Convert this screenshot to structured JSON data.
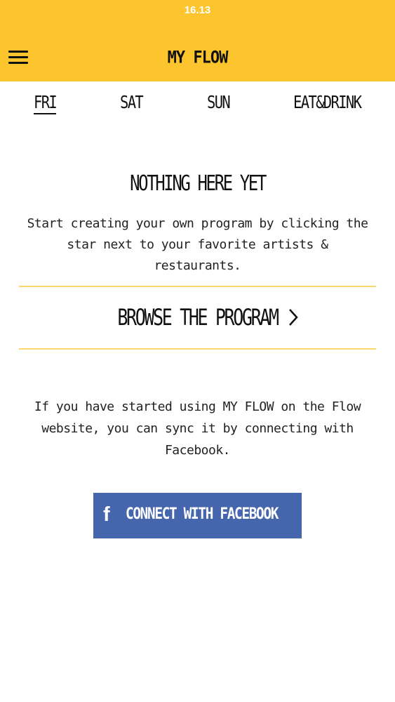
{
  "status_bar": {
    "time": "16.13"
  },
  "header": {
    "title": "MY FLOW",
    "menu_icon": "hamburger-menu-icon",
    "background": "#fcc52e"
  },
  "tabs": [
    {
      "label": "FRI",
      "active": true
    },
    {
      "label": "SAT",
      "active": false
    },
    {
      "label": "SUN",
      "active": false
    },
    {
      "label": "EAT&DRINK",
      "active": false
    }
  ],
  "empty_state": {
    "title": "NOTHING HERE YET",
    "line1": "Start creating your own program by clicking the",
    "line2": "star next to your favorite artists & restaurants."
  },
  "browse": {
    "label": "BROWSE THE PROGRAM",
    "icon": "chevron-right-icon",
    "divider_color": "#fcd86a"
  },
  "sync": {
    "line1": "If you have started using MY FLOW on the Flow",
    "line2": "website, you can sync it by connecting with",
    "line3": "Facebook."
  },
  "facebook_button": {
    "label": "CONNECT WITH FACEBOOK",
    "icon": "facebook-icon",
    "color": "#4566ad"
  }
}
